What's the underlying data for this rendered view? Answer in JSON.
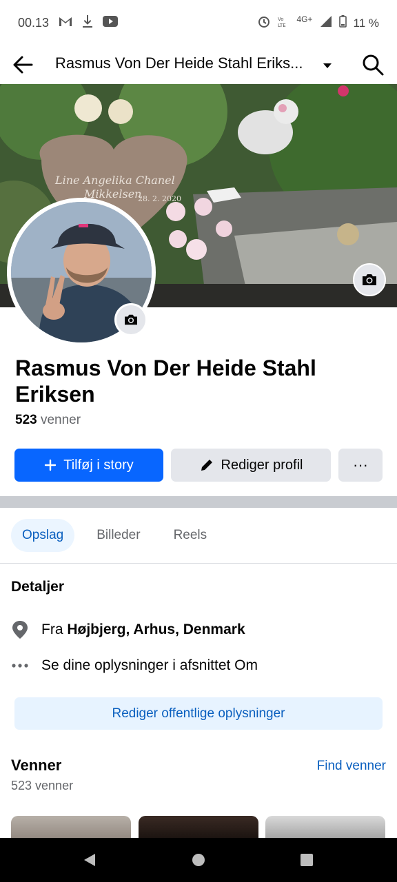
{
  "status_bar": {
    "time": "00.13",
    "left_icons": [
      "gmail-icon",
      "download-icon",
      "youtube-icon"
    ],
    "network": "4G+",
    "battery": "11 %"
  },
  "top_bar": {
    "title": "Rasmus Von Der Heide Stahl Eriks..."
  },
  "profile": {
    "name": "Rasmus Von Der Heide Stahl Eriksen",
    "friends_count_value": "523",
    "friends_count_label": "venner"
  },
  "actions": {
    "add_story": "Tilføj i story",
    "edit_profile": "Rediger profil",
    "more": "···"
  },
  "tabs": [
    {
      "label": "Opslag",
      "active": true
    },
    {
      "label": "Billeder",
      "active": false
    },
    {
      "label": "Reels",
      "active": false
    }
  ],
  "details": {
    "title": "Detaljer",
    "from_prefix": "Fra",
    "from_place": "Højbjerg, Arhus, Denmark",
    "see_info": "Se dine oplysninger i afsnittet Om",
    "edit_public": "Rediger offentlige oplysninger"
  },
  "friends_section": {
    "title": "Venner",
    "find": "Find venner",
    "count": "523 venner"
  },
  "cover_text": {
    "line1": "Line Angelika Chanel",
    "line2": "Mikkelsen",
    "line3": "28. 2. 2020"
  },
  "colors": {
    "primary": "#0866ff",
    "link": "#0a5fbf",
    "secondary_bg": "#e4e6eb"
  }
}
